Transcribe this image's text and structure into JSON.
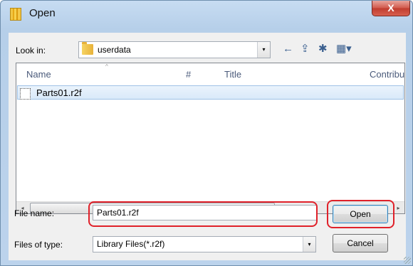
{
  "window": {
    "title": "Open",
    "close_label": "X"
  },
  "lookin": {
    "label": "Look in:",
    "value": "userdata",
    "dropdown_glyph": "▾"
  },
  "toolbar": {
    "back_icon": "←",
    "up_folder_icon": "⇪",
    "new_folder_icon": "✱",
    "view_menu_icon": "▦▾"
  },
  "columns": {
    "name": "Name",
    "number": "#",
    "title": "Title",
    "contributor": "Contribu"
  },
  "files": [
    {
      "name": "Parts01.r2f",
      "selected": true
    }
  ],
  "scrollbar": {
    "left": "◂",
    "right": "▸",
    "grip": "III"
  },
  "filename": {
    "label": "File name:",
    "value": "Parts01.r2f"
  },
  "filetype": {
    "label": "Files of type:",
    "value": "Library Files(*.r2f)",
    "dropdown_glyph": "▾"
  },
  "buttons": {
    "open": "Open",
    "cancel": "Cancel"
  },
  "colors": {
    "highlight": "#e0212a",
    "selection": "#d9e9f9"
  }
}
